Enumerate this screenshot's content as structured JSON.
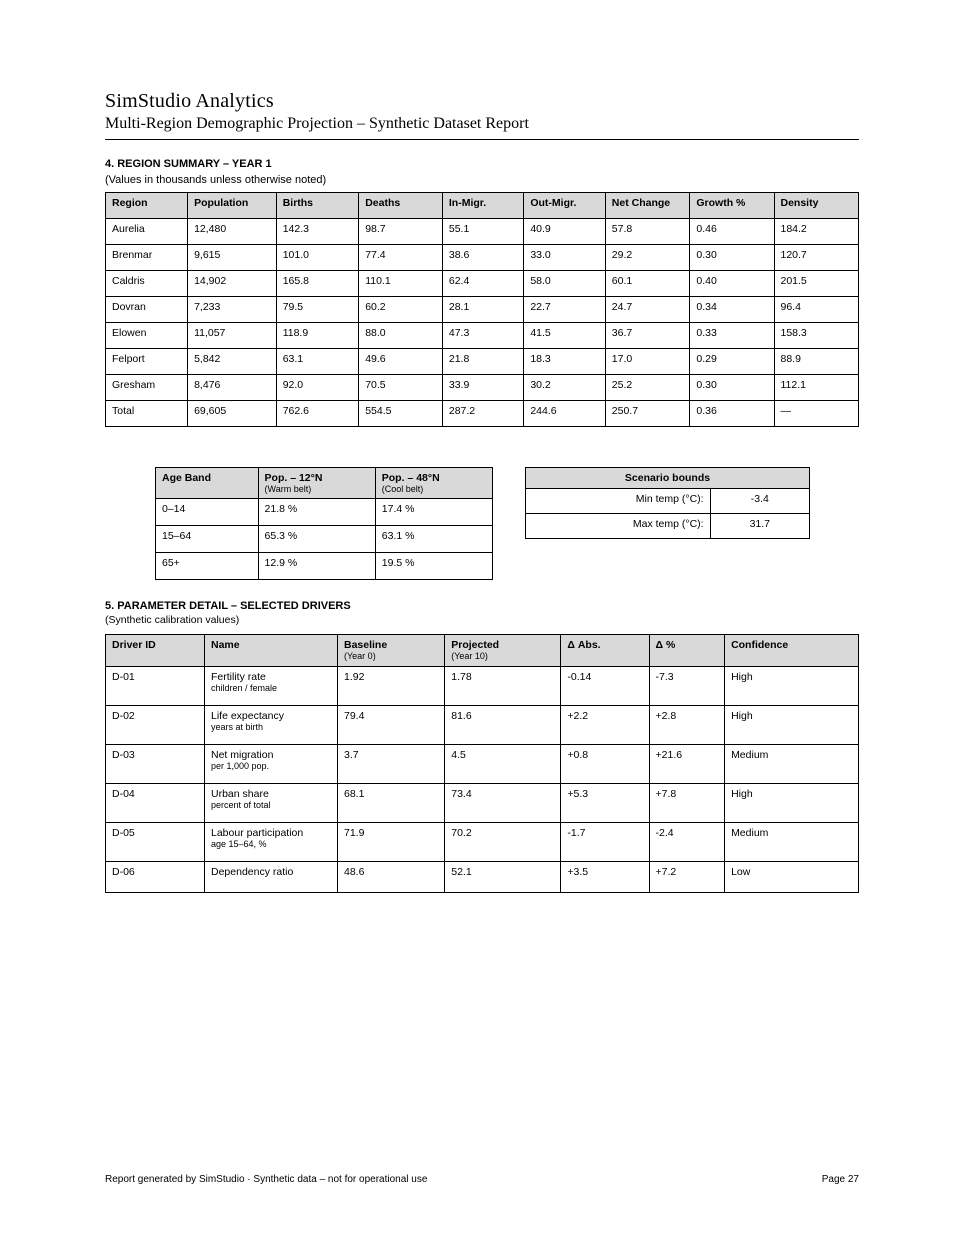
{
  "header": {
    "title": "SimStudio Analytics",
    "subtitle": "Multi-Region Demographic Projection – Synthetic Dataset Report"
  },
  "section1": {
    "tag": "4.  REGION SUMMARY – YEAR 1",
    "note": "(Values in thousands unless otherwise noted)",
    "columns": [
      "Region",
      "Population",
      "Births",
      "Deaths",
      "In-Migr.",
      "Out-Migr.",
      "Net Change",
      "Growth %",
      "Density"
    ],
    "rows": [
      [
        "Aurelia",
        "12,480",
        "142.3",
        "98.7",
        "55.1",
        "40.9",
        "57.8",
        "0.46",
        "184.2"
      ],
      [
        "Brenmar",
        "9,615",
        "101.0",
        "77.4",
        "38.6",
        "33.0",
        "29.2",
        "0.30",
        "120.7"
      ],
      [
        "Caldris",
        "14,902",
        "165.8",
        "110.1",
        "62.4",
        "58.0",
        "60.1",
        "0.40",
        "201.5"
      ],
      [
        "Dovran",
        "7,233",
        "79.5",
        "60.2",
        "28.1",
        "22.7",
        "24.7",
        "0.34",
        "96.4"
      ],
      [
        "Elowen",
        "11,057",
        "118.9",
        "88.0",
        "47.3",
        "41.5",
        "36.7",
        "0.33",
        "158.3"
      ],
      [
        "Felport",
        "5,842",
        "63.1",
        "49.6",
        "21.8",
        "18.3",
        "17.0",
        "0.29",
        "88.9"
      ],
      [
        "Gresham",
        "8,476",
        "92.0",
        "70.5",
        "33.9",
        "30.2",
        "25.2",
        "0.30",
        "112.1"
      ],
      [
        "Total",
        "69,605",
        "762.6",
        "554.5",
        "287.2",
        "244.6",
        "250.7",
        "0.36",
        "—"
      ]
    ]
  },
  "popBox": {
    "columns": [
      {
        "head": "Age Band"
      },
      {
        "head": "Pop. – 12°N",
        "sub": "(Warm belt)"
      },
      {
        "head": "Pop. – 48°N",
        "sub": "(Cool belt)"
      }
    ],
    "rows": [
      [
        "0–14",
        "21.8 %",
        "17.4 %"
      ],
      [
        "15–64",
        "65.3 %",
        "63.1 %"
      ],
      [
        "65+",
        "12.9 %",
        "19.5 %"
      ]
    ]
  },
  "minmax": {
    "header": "Scenario bounds",
    "rows": [
      {
        "label": "Min temp  (°C):",
        "val": "-3.4"
      },
      {
        "label": "Max temp (°C):",
        "val": "31.7"
      }
    ]
  },
  "section2": {
    "tag": "5.  PARAMETER DETAIL – SELECTED DRIVERS",
    "note": "(Synthetic calibration values)",
    "columns": [
      {
        "head": "Driver ID"
      },
      {
        "head": "Name"
      },
      {
        "head": "Baseline",
        "sub": "(Year 0)"
      },
      {
        "head": "Projected",
        "sub": "(Year 10)"
      },
      {
        "head": "Δ Abs."
      },
      {
        "head": "Δ %"
      },
      {
        "head": "Confidence"
      }
    ],
    "rows": [
      [
        "D-01",
        [
          "Fertility rate",
          "children / female"
        ],
        "1.92",
        "1.78",
        "-0.14",
        "-7.3",
        "High"
      ],
      [
        "D-02",
        [
          "Life expectancy",
          "years at birth"
        ],
        "79.4",
        "81.6",
        "+2.2",
        "+2.8",
        "High"
      ],
      [
        "D-03",
        [
          "Net migration",
          "per 1,000 pop."
        ],
        "3.7",
        "4.5",
        "+0.8",
        "+21.6",
        "Medium"
      ],
      [
        "D-04",
        [
          "Urban share",
          "percent of total"
        ],
        "68.1",
        "73.4",
        "+5.3",
        "+7.8",
        "High"
      ],
      [
        "D-05",
        [
          "Labour participation",
          "age 15–64, %"
        ],
        "71.9",
        "70.2",
        "-1.7",
        "-2.4",
        "Medium"
      ],
      [
        "D-06",
        [
          "Dependency ratio",
          ""
        ],
        "48.6",
        "52.1",
        "+3.5",
        "+7.2",
        "Low"
      ]
    ]
  },
  "footer": {
    "left": "Report generated by SimStudio · Synthetic data – not for operational use",
    "right": "Page 27"
  }
}
